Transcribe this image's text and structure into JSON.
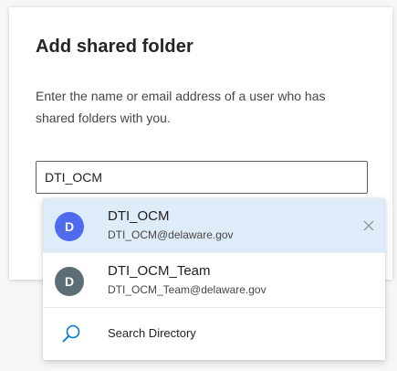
{
  "dialog": {
    "title": "Add shared folder",
    "description": "Enter the name or email address of a user who has shared folders with you.",
    "input_value": "DTI_OCM"
  },
  "suggestions": [
    {
      "initial": "D",
      "name": "DTI_OCM",
      "email": "DTI_OCM@delaware.gov",
      "avatar_color": "#4f6bed",
      "highlighted": true,
      "remove_icon": "close-icon"
    },
    {
      "initial": "D",
      "name": "DTI_OCM_Team",
      "email": "DTI_OCM_Team@delaware.gov",
      "avatar_color": "#5c6e75",
      "highlighted": false
    }
  ],
  "search_directory": {
    "label": "Search Directory",
    "icon": "search-icon"
  },
  "colors": {
    "highlight_bg": "#deecf9",
    "accent": "#0078d4"
  }
}
